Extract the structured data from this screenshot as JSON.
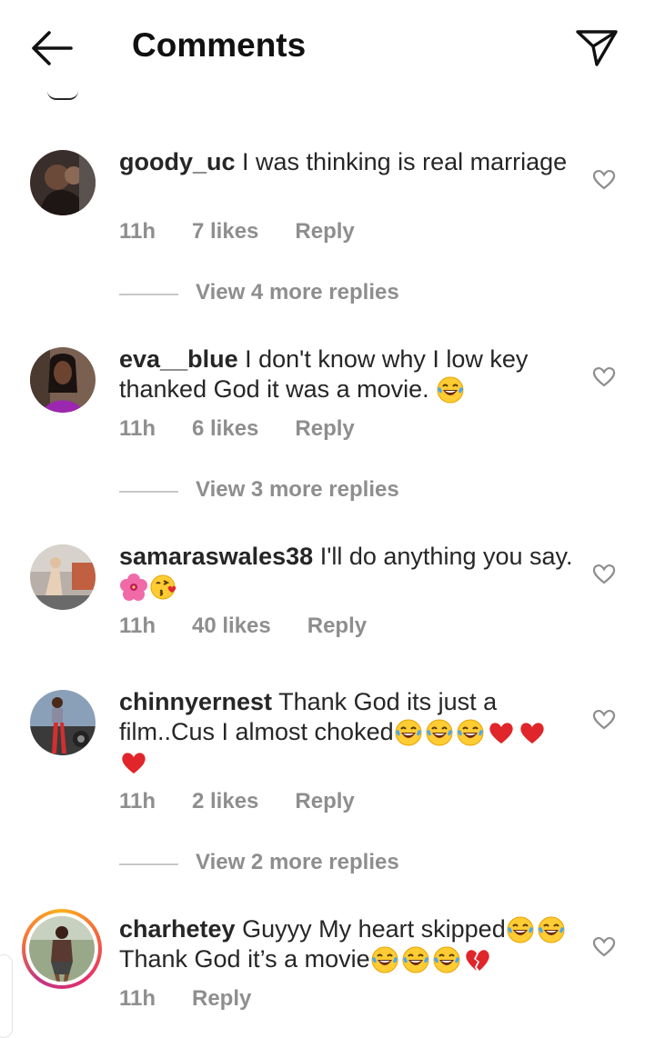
{
  "header": {
    "title": "Comments",
    "back_icon": "arrow-left-icon",
    "send_icon": "paper-plane-icon"
  },
  "comments": [
    {
      "username": "goody_uc",
      "text": "I was thinking is real marriage",
      "time": "11h",
      "likes": "7 likes",
      "reply": "Reply",
      "view_replies": "View 4 more replies"
    },
    {
      "username": "eva__blue",
      "text": "I don't know why I low key thanked God it was a movie.",
      "emojis": [
        "face-with-tears-of-joy"
      ],
      "time": "11h",
      "likes": "6 likes",
      "reply": "Reply",
      "view_replies": "View 3 more replies"
    },
    {
      "username": "samaraswales38",
      "text": "I'll do anything you say.",
      "emojis": [
        "hibiscus",
        "face-blowing-kiss"
      ],
      "time": "11h",
      "likes": "40 likes",
      "reply": "Reply"
    },
    {
      "username": "chinnyernest",
      "text": "Thank God its just a film..Cus I almost choked",
      "emojis": [
        "face-with-tears-of-joy",
        "face-with-tears-of-joy",
        "face-with-tears-of-joy",
        "red-heart",
        "red-heart",
        "red-heart"
      ],
      "time": "11h",
      "likes": "2 likes",
      "reply": "Reply",
      "view_replies": "View 2 more replies"
    },
    {
      "username": "charhetey",
      "text_line1": "Guyyy My heart skipped",
      "text_line2": "Thank God it’s a movie",
      "emojis": [
        "face-with-tears-of-joy",
        "face-with-tears-of-joy",
        "face-with-tears-of-joy",
        "face-with-tears-of-joy",
        "face-with-tears-of-joy",
        "broken-heart"
      ],
      "time": "11h",
      "reply": "Reply",
      "has_story_ring": true
    }
  ],
  "colors": {
    "text": "#262626",
    "meta": "#8e8e8e",
    "divider": "#c7c7c7",
    "heart_red": "#e0252b"
  }
}
